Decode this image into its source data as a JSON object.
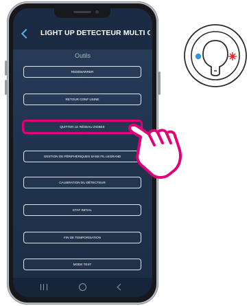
{
  "app": {
    "title": "LIGHT UP DETECTEUR MULTI C...",
    "section_title": "Outils"
  },
  "menu": {
    "items": [
      {
        "label": "REDÉMARRER",
        "highlighted": false
      },
      {
        "label": "RETOUR CONF USINE",
        "highlighted": false
      },
      {
        "label": "QUITTER LE RÉSEAU ZIGBEE",
        "highlighted": true
      },
      {
        "label": "GESTION DE PÉRIPHÉRIQUES SANS FIL LEGRAND",
        "highlighted": false
      },
      {
        "label": "CALIBRATION DU DÉTECTEUR",
        "highlighted": false
      },
      {
        "label": "ETAT INITIAL",
        "highlighted": false
      },
      {
        "label": "FIN DE TEMPORISATION",
        "highlighted": false
      },
      {
        "label": "MODE TEST",
        "highlighted": false
      }
    ]
  },
  "colors": {
    "highlight": "#e2007a",
    "accent": "#5ab0e6",
    "led_blue": "#2a9be0",
    "led_red": "#e8262b"
  },
  "icons": {
    "back": "chevron-left-icon",
    "pointer": "pointing-hand-icon",
    "nav_recent": "recent-apps-icon",
    "nav_home": "home-icon",
    "nav_back": "back-icon"
  }
}
